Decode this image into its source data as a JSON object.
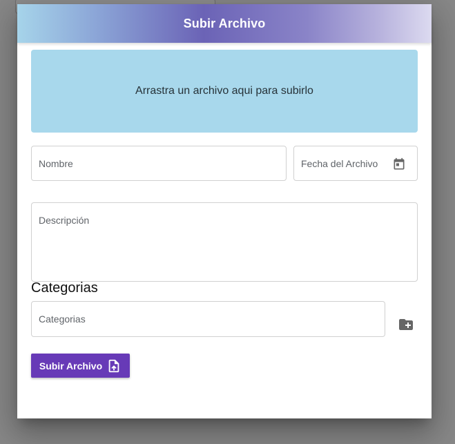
{
  "dialog": {
    "title": "Subir Archivo",
    "dropzone_text": "Arrastra un archivo aqui para subirlo"
  },
  "form": {
    "name_label": "Nombre",
    "date_label": "Fecha del Archivo",
    "description_label": "Descripción",
    "categories_heading": "Categorias",
    "categories_label": "Categorias",
    "submit_label": "Subir Archivo"
  },
  "icons": {
    "date": "calendar-icon",
    "add_category": "folder-add-icon",
    "submit": "file-upload-icon"
  },
  "colors": {
    "primary": "#673ab7",
    "dropzone": "#a8d8ec",
    "icon": "#666666"
  }
}
